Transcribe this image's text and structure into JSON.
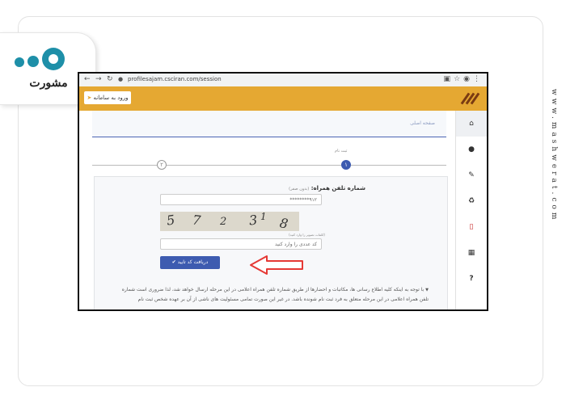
{
  "brand": {
    "logo_text": "مشورت",
    "site_url": "www.mashwerat.com"
  },
  "browser": {
    "url": "profilesajam.csciran.com/session"
  },
  "header": {
    "login_label": "ورود به سامانه"
  },
  "breadcrumb": {
    "label": "صفحه اصلی"
  },
  "steps": {
    "active_label": "ثبت نام",
    "active_num": "۱",
    "pending_num": "۲"
  },
  "form": {
    "phone_label": "شماره تلفن همراه:",
    "phone_hint": "(بدون صفر)",
    "phone_placeholder": "۹۱۲********",
    "captcha_chars": [
      "5",
      "7",
      "2",
      "3",
      "1",
      "8"
    ],
    "captcha_note": "(کلمات تصویر را وارد کنید)",
    "captcha_placeholder": "کد عددی را وارد کنید",
    "submit_label": "دریافت کد تایید"
  },
  "notice": {
    "line1": "با توجه به اینکه کلیه اطلاع رسانی ها، مکاتبات و احضارها از طریق شماره تلفن همراه اعلامی در این مرحله ارسال خواهد شد، لذا ضروری است شماره",
    "line2": "تلفن همراه اعلامی در این مرحله متعلق به فرد ثبت نام شونده باشد. در غیر این صورت تمامی مسئولیت های ناشی از آن بر عهده شخص ثبت نام"
  },
  "colors": {
    "header": "#e5a832",
    "accent": "#3d5bb0",
    "arrow": "#e53935",
    "logo_dot": "#1e8fa8"
  },
  "icons": [
    "home-icon",
    "user-icon",
    "edit-icon",
    "recycle-icon",
    "mobile-icon",
    "building-icon",
    "question-icon"
  ]
}
